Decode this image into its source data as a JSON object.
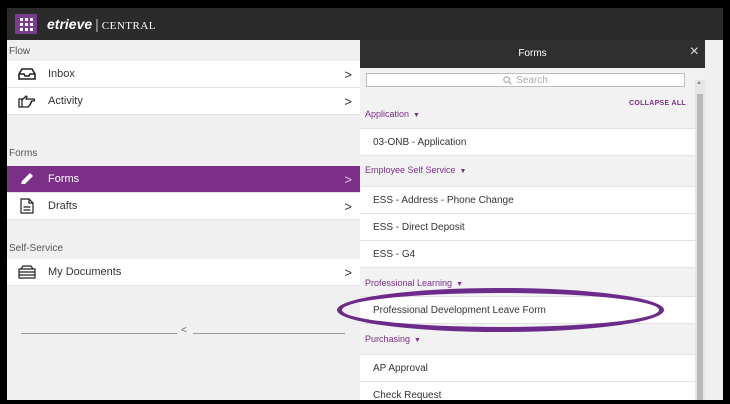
{
  "topbar": {
    "brand_logo": "etrieve",
    "brand_separator": "|",
    "brand_app": "CENTRAL"
  },
  "nav": {
    "sections": {
      "flow": "Flow",
      "forms": "Forms",
      "self_service": "Self-Service"
    },
    "items": {
      "inbox": "Inbox",
      "activity": "Activity",
      "forms": "Forms",
      "drafts": "Drafts",
      "my_documents": "My Documents"
    },
    "chevron": ">",
    "collapse_handle": "<"
  },
  "panel": {
    "title": "Forms",
    "close": "×",
    "search_placeholder": "Search",
    "collapse_all": "COLLAPSE ALL",
    "categories": {
      "application": {
        "label": "Application",
        "items": [
          "03-ONB - Application"
        ]
      },
      "employee_self_service": {
        "label": "Employee Self Service",
        "items": [
          "ESS - Address - Phone Change",
          "ESS - Direct Deposit",
          "ESS - G4"
        ]
      },
      "professional_learning": {
        "label": "Professional Learning",
        "items": [
          "Professional Development Leave Form"
        ]
      },
      "purchasing": {
        "label": "Purchasing",
        "items": [
          "AP Approval",
          "Check Request"
        ]
      }
    },
    "expand_glyph": "▼"
  },
  "colors": {
    "accent": "#7b2f87",
    "topbar": "#2b2b2b",
    "highlight_oval": "#6c2a8a"
  }
}
